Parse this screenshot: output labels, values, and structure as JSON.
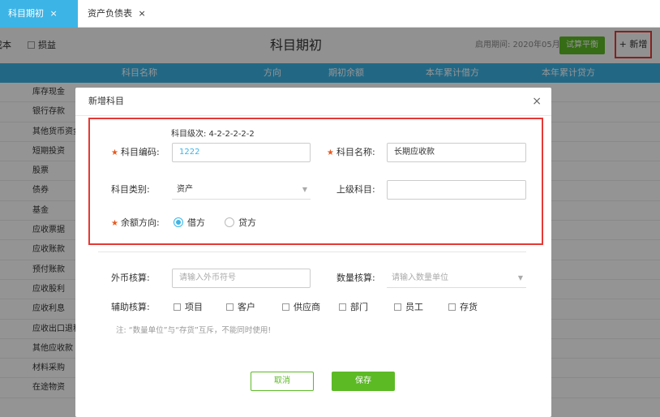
{
  "tabs": [
    {
      "label": "科目期初",
      "close": "×"
    },
    {
      "label": "资产负债表",
      "close": "×"
    }
  ],
  "toolbar": {
    "left_btn1": "成本",
    "left_btn2": "损益",
    "title": "科目期初",
    "period_label": "启用期间: 2020年05月",
    "trial_balance": "试算平衡",
    "new_button": "+ 新增"
  },
  "table": {
    "headers": [
      "科目名称",
      "方向",
      "期初余额",
      "本年累计借方",
      "本年累计贷方"
    ],
    "rows": [
      "库存现金",
      "银行存款",
      "其他货币资金",
      "短期投资",
      "股票",
      "债券",
      "基金",
      "应收票据",
      "应收账款",
      "预付账款",
      "应收股利",
      "应收利息",
      "应收出口退税",
      "其他应收款",
      "材料采购",
      "在途物资"
    ]
  },
  "modal": {
    "title": "新增科目",
    "close": "×",
    "level_hint": "科目级次: 4-2-2-2-2-2",
    "code_label": "科目编码:",
    "code_value": "1222",
    "name_label": "科目名称:",
    "name_value": "长期应收款",
    "category_label": "科目类别:",
    "category_value": "资产",
    "parent_label": "上级科目:",
    "parent_value": "",
    "direction_label": "余额方向:",
    "direction_debit": "借方",
    "direction_credit": "贷方",
    "currency_label": "外币核算:",
    "currency_placeholder": "请输入外币符号",
    "quantity_label": "数量核算:",
    "quantity_placeholder": "请输入数量单位",
    "aux_label": "辅助核算:",
    "aux_options": [
      "项目",
      "客户",
      "供应商",
      "部门",
      "员工",
      "存货"
    ],
    "note": "注: “数量单位”与“存货”互斥，不能同时使用!",
    "cancel": "取消",
    "save": "保存"
  },
  "colors": {
    "accent": "#3cb4e6",
    "primary_button": "#5cba25",
    "highlight_border": "#e53935",
    "required_star": "#e65a1f"
  }
}
